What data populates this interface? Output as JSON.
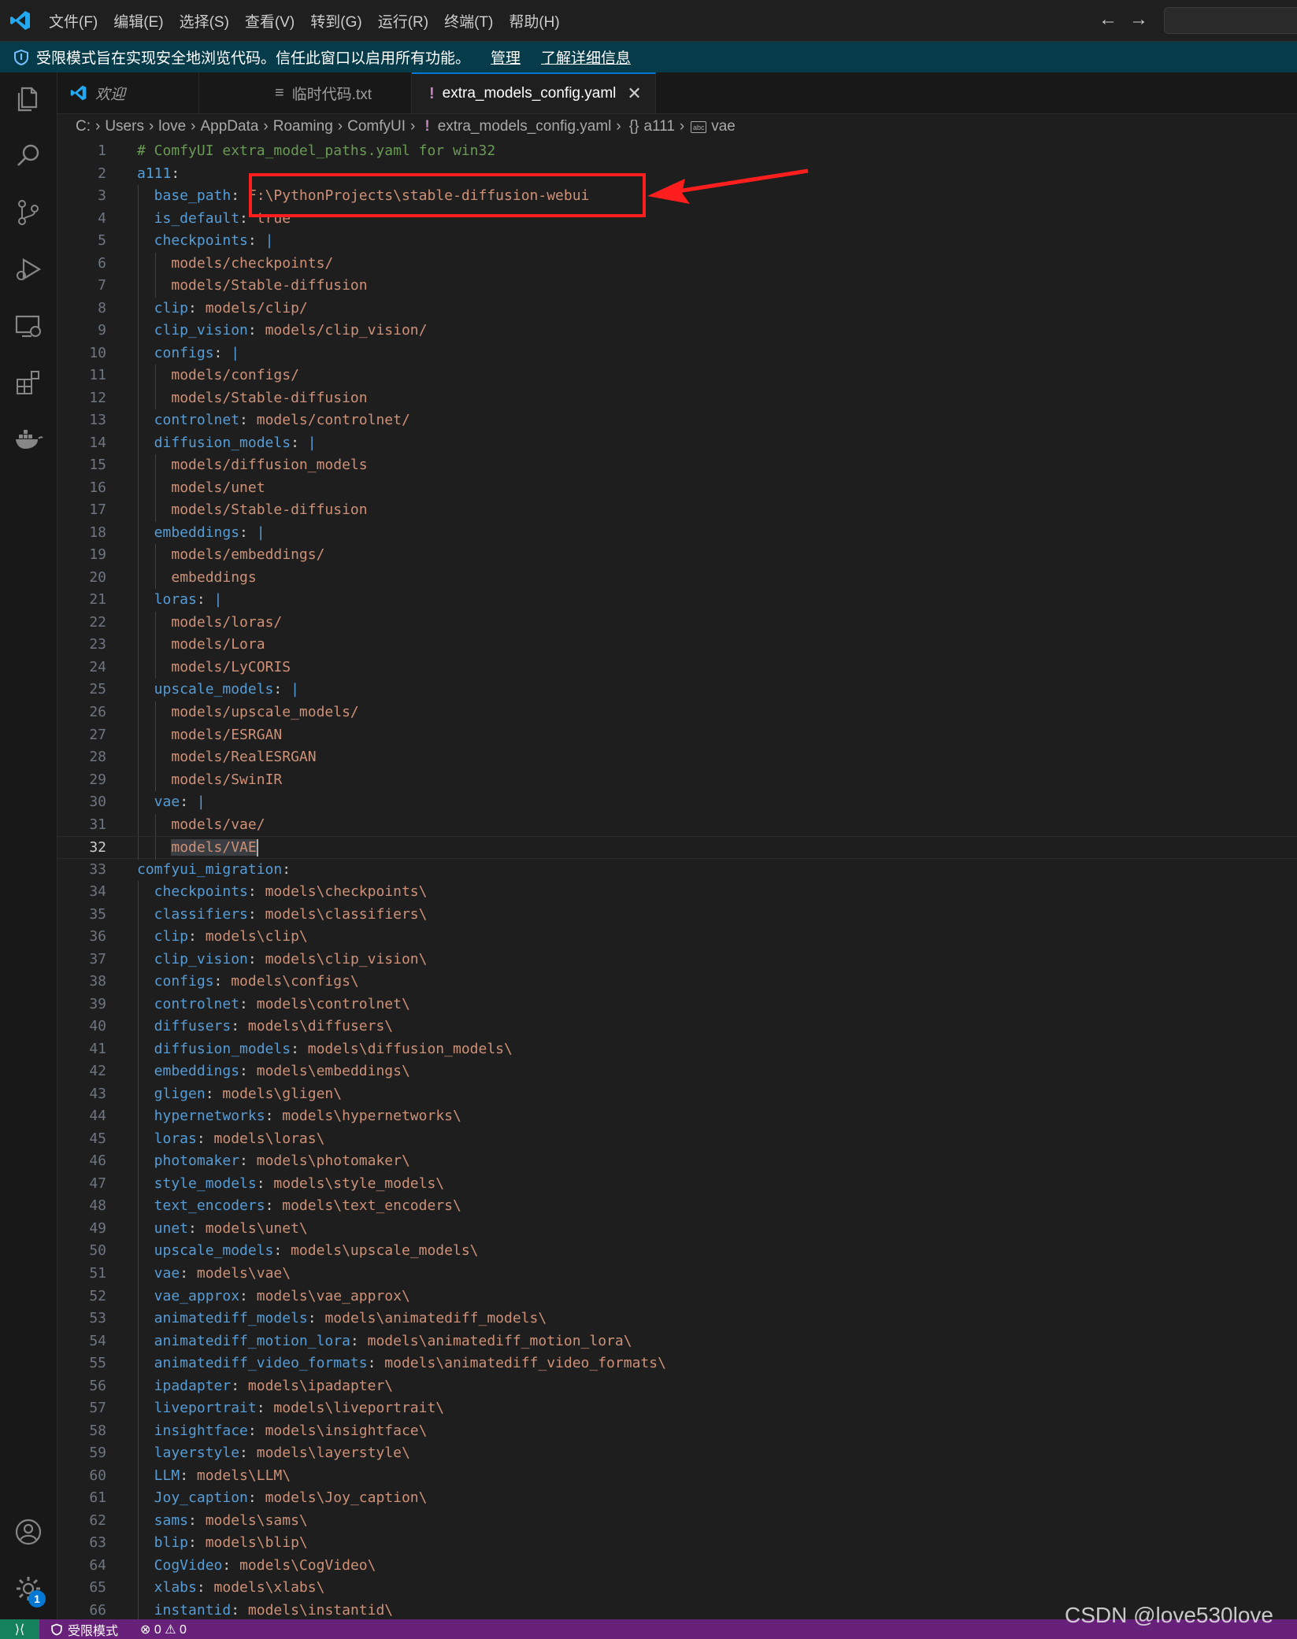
{
  "menu": [
    "文件(F)",
    "编辑(E)",
    "选择(S)",
    "查看(V)",
    "转到(G)",
    "运行(R)",
    "终端(T)",
    "帮助(H)"
  ],
  "banner": {
    "text": "受限模式旨在实现安全地浏览代码。信任此窗口以启用所有功能。",
    "manage": "管理",
    "learn_more": "了解详细信息"
  },
  "tabs": {
    "welcome": "欢迎",
    "temp": "临时代码.txt",
    "config": "extra_models_config.yaml",
    "config_icon": "!"
  },
  "breadcrumb": {
    "parts": [
      "C:",
      "Users",
      "love",
      "AppData",
      "Roaming",
      "ComfyUI"
    ],
    "file_icon": "!",
    "file": "extra_models_config.yaml",
    "sym_icon": "{}",
    "sym": "a111",
    "leaf_icon": "abc",
    "leaf": "vae"
  },
  "editor": {
    "current_line": 32,
    "lines": [
      {
        "n": 1,
        "i": 0,
        "t": "comment",
        "text": "# ComfyUI extra_model_paths.yaml for win32"
      },
      {
        "n": 2,
        "i": 0,
        "t": "key",
        "key": "a111",
        "val": ""
      },
      {
        "n": 3,
        "i": 1,
        "t": "key",
        "key": "base_path",
        "val": "F:\\PythonProjects\\stable-diffusion-webui"
      },
      {
        "n": 4,
        "i": 1,
        "t": "key",
        "key": "is_default",
        "val": "true"
      },
      {
        "n": 5,
        "i": 1,
        "t": "block",
        "key": "checkpoints"
      },
      {
        "n": 6,
        "i": 2,
        "t": "str",
        "text": "models/checkpoints/"
      },
      {
        "n": 7,
        "i": 2,
        "t": "str",
        "text": "models/Stable-diffusion"
      },
      {
        "n": 8,
        "i": 1,
        "t": "key",
        "key": "clip",
        "val": "models/clip/"
      },
      {
        "n": 9,
        "i": 1,
        "t": "key",
        "key": "clip_vision",
        "val": "models/clip_vision/"
      },
      {
        "n": 10,
        "i": 1,
        "t": "block",
        "key": "configs"
      },
      {
        "n": 11,
        "i": 2,
        "t": "str",
        "text": "models/configs/"
      },
      {
        "n": 12,
        "i": 2,
        "t": "str",
        "text": "models/Stable-diffusion"
      },
      {
        "n": 13,
        "i": 1,
        "t": "key",
        "key": "controlnet",
        "val": "models/controlnet/"
      },
      {
        "n": 14,
        "i": 1,
        "t": "block",
        "key": "diffusion_models"
      },
      {
        "n": 15,
        "i": 2,
        "t": "str",
        "text": "models/diffusion_models"
      },
      {
        "n": 16,
        "i": 2,
        "t": "str",
        "text": "models/unet"
      },
      {
        "n": 17,
        "i": 2,
        "t": "str",
        "text": "models/Stable-diffusion"
      },
      {
        "n": 18,
        "i": 1,
        "t": "block",
        "key": "embeddings"
      },
      {
        "n": 19,
        "i": 2,
        "t": "str",
        "text": "models/embeddings/"
      },
      {
        "n": 20,
        "i": 2,
        "t": "str",
        "text": "embeddings"
      },
      {
        "n": 21,
        "i": 1,
        "t": "block",
        "key": "loras"
      },
      {
        "n": 22,
        "i": 2,
        "t": "str",
        "text": "models/loras/"
      },
      {
        "n": 23,
        "i": 2,
        "t": "str",
        "text": "models/Lora"
      },
      {
        "n": 24,
        "i": 2,
        "t": "str",
        "text": "models/LyCORIS"
      },
      {
        "n": 25,
        "i": 1,
        "t": "block",
        "key": "upscale_models"
      },
      {
        "n": 26,
        "i": 2,
        "t": "str",
        "text": "models/upscale_models/"
      },
      {
        "n": 27,
        "i": 2,
        "t": "str",
        "text": "models/ESRGAN"
      },
      {
        "n": 28,
        "i": 2,
        "t": "str",
        "text": "models/RealESRGAN"
      },
      {
        "n": 29,
        "i": 2,
        "t": "str",
        "text": "models/SwinIR"
      },
      {
        "n": 30,
        "i": 1,
        "t": "block",
        "key": "vae"
      },
      {
        "n": 31,
        "i": 2,
        "t": "str",
        "text": "models/vae/"
      },
      {
        "n": 32,
        "i": 2,
        "t": "sel",
        "text": "models/VAE"
      },
      {
        "n": 33,
        "i": 0,
        "t": "key",
        "key": "comfyui_migration",
        "val": ""
      },
      {
        "n": 34,
        "i": 1,
        "t": "key",
        "key": "checkpoints",
        "val": "models\\checkpoints\\"
      },
      {
        "n": 35,
        "i": 1,
        "t": "key",
        "key": "classifiers",
        "val": "models\\classifiers\\"
      },
      {
        "n": 36,
        "i": 1,
        "t": "key",
        "key": "clip",
        "val": "models\\clip\\"
      },
      {
        "n": 37,
        "i": 1,
        "t": "key",
        "key": "clip_vision",
        "val": "models\\clip_vision\\"
      },
      {
        "n": 38,
        "i": 1,
        "t": "key",
        "key": "configs",
        "val": "models\\configs\\"
      },
      {
        "n": 39,
        "i": 1,
        "t": "key",
        "key": "controlnet",
        "val": "models\\controlnet\\"
      },
      {
        "n": 40,
        "i": 1,
        "t": "key",
        "key": "diffusers",
        "val": "models\\diffusers\\"
      },
      {
        "n": 41,
        "i": 1,
        "t": "key",
        "key": "diffusion_models",
        "val": "models\\diffusion_models\\"
      },
      {
        "n": 42,
        "i": 1,
        "t": "key",
        "key": "embeddings",
        "val": "models\\embeddings\\"
      },
      {
        "n": 43,
        "i": 1,
        "t": "key",
        "key": "gligen",
        "val": "models\\gligen\\"
      },
      {
        "n": 44,
        "i": 1,
        "t": "key",
        "key": "hypernetworks",
        "val": "models\\hypernetworks\\"
      },
      {
        "n": 45,
        "i": 1,
        "t": "key",
        "key": "loras",
        "val": "models\\loras\\"
      },
      {
        "n": 46,
        "i": 1,
        "t": "key",
        "key": "photomaker",
        "val": "models\\photomaker\\"
      },
      {
        "n": 47,
        "i": 1,
        "t": "key",
        "key": "style_models",
        "val": "models\\style_models\\"
      },
      {
        "n": 48,
        "i": 1,
        "t": "key",
        "key": "text_encoders",
        "val": "models\\text_encoders\\"
      },
      {
        "n": 49,
        "i": 1,
        "t": "key",
        "key": "unet",
        "val": "models\\unet\\"
      },
      {
        "n": 50,
        "i": 1,
        "t": "key",
        "key": "upscale_models",
        "val": "models\\upscale_models\\"
      },
      {
        "n": 51,
        "i": 1,
        "t": "key",
        "key": "vae",
        "val": "models\\vae\\"
      },
      {
        "n": 52,
        "i": 1,
        "t": "key",
        "key": "vae_approx",
        "val": "models\\vae_approx\\"
      },
      {
        "n": 53,
        "i": 1,
        "t": "key",
        "key": "animatediff_models",
        "val": "models\\animatediff_models\\"
      },
      {
        "n": 54,
        "i": 1,
        "t": "key",
        "key": "animatediff_motion_lora",
        "val": "models\\animatediff_motion_lora\\"
      },
      {
        "n": 55,
        "i": 1,
        "t": "key",
        "key": "animatediff_video_formats",
        "val": "models\\animatediff_video_formats\\"
      },
      {
        "n": 56,
        "i": 1,
        "t": "key",
        "key": "ipadapter",
        "val": "models\\ipadapter\\"
      },
      {
        "n": 57,
        "i": 1,
        "t": "key",
        "key": "liveportrait",
        "val": "models\\liveportrait\\"
      },
      {
        "n": 58,
        "i": 1,
        "t": "key",
        "key": "insightface",
        "val": "models\\insightface\\"
      },
      {
        "n": 59,
        "i": 1,
        "t": "key",
        "key": "layerstyle",
        "val": "models\\layerstyle\\"
      },
      {
        "n": 60,
        "i": 1,
        "t": "key",
        "key": "LLM",
        "val": "models\\LLM\\"
      },
      {
        "n": 61,
        "i": 1,
        "t": "key",
        "key": "Joy_caption",
        "val": "models\\Joy_caption\\"
      },
      {
        "n": 62,
        "i": 1,
        "t": "key",
        "key": "sams",
        "val": "models\\sams\\"
      },
      {
        "n": 63,
        "i": 1,
        "t": "key",
        "key": "blip",
        "val": "models\\blip\\"
      },
      {
        "n": 64,
        "i": 1,
        "t": "key",
        "key": "CogVideo",
        "val": "models\\CogVideo\\"
      },
      {
        "n": 65,
        "i": 1,
        "t": "key",
        "key": "xlabs",
        "val": "models\\xlabs\\"
      },
      {
        "n": 66,
        "i": 1,
        "t": "key",
        "key": "instantid",
        "val": "models\\instantid\\"
      }
    ]
  },
  "status": {
    "remote": "⟩⟨",
    "restricted": "受限模式",
    "errors": "0",
    "warnings": "0",
    "settings_badge": "1"
  },
  "watermark": "CSDN @love530love",
  "icons": [
    "vscode-logo",
    "shield-icon",
    "explorer-icon",
    "search-icon",
    "source-control-icon",
    "run-debug-icon",
    "remote-explorer-icon",
    "extensions-icon",
    "docker-icon",
    "account-icon",
    "settings-gear-icon"
  ],
  "colors": {
    "keyword": "#569cd6",
    "string": "#ce9178",
    "comment": "#6a9955",
    "status_bar": "#68217a",
    "banner": "#063b49",
    "annotation": "#ff1e1e"
  }
}
